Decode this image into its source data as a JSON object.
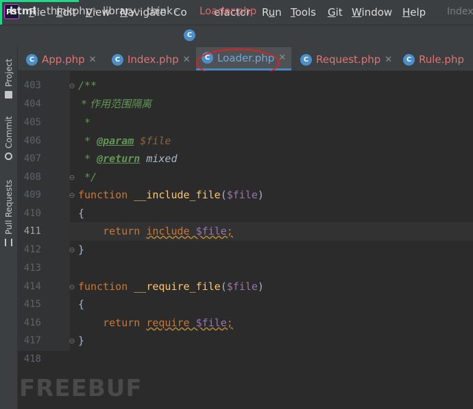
{
  "app": {
    "logo_text": "PS",
    "project_title": "Index"
  },
  "menu": [
    {
      "label": "File",
      "mnemonic": "F",
      "rest": "ile"
    },
    {
      "label": "Edit",
      "mnemonic": "E",
      "rest": "dit"
    },
    {
      "label": "View",
      "mnemonic": "V",
      "rest": "iew"
    },
    {
      "label": "Navigate",
      "mnemonic": "N",
      "rest": "avigate"
    },
    {
      "label": "Code",
      "mnemonic": "",
      "rest": "Co"
    },
    {
      "label": "Refactor",
      "mnemonic": "",
      "rest": "efactor"
    },
    {
      "label": "Run",
      "mnemonic": "u",
      "rest": "Rn"
    },
    {
      "label": "Tools",
      "mnemonic": "T",
      "rest": "ools"
    },
    {
      "label": "Git",
      "mnemonic": "G",
      "rest": "it"
    },
    {
      "label": "Window",
      "mnemonic": "W",
      "rest": "indow"
    },
    {
      "label": "Help",
      "mnemonic": "H",
      "rest": "elp"
    }
  ],
  "breadcrumb": {
    "items": [
      "html",
      "thinkphp",
      "library",
      "think"
    ],
    "file": "Loader.php",
    "file_icon": "class-c-icon"
  },
  "sidebar": {
    "tabs": [
      {
        "label": "Project",
        "icon": "folder-icon"
      },
      {
        "label": "Commit",
        "icon": "commit-icon"
      },
      {
        "label": "Pull Requests",
        "icon": "pull-request-icon"
      }
    ]
  },
  "tabs": [
    {
      "label": "App.php",
      "icon": "class-c-icon",
      "active": false
    },
    {
      "label": "Index.php",
      "icon": "class-c-icon",
      "active": false
    },
    {
      "label": "Loader.php",
      "icon": "class-c-icon",
      "active": true
    },
    {
      "label": "Request.php",
      "icon": "class-c-icon",
      "active": false
    },
    {
      "label": "Rule.php",
      "icon": "class-c-icon",
      "active": false
    }
  ],
  "editor": {
    "current_line": 411,
    "lines": [
      {
        "n": "403",
        "text": "/**"
      },
      {
        "n": "404",
        "text": " * 作用范围隔离"
      },
      {
        "n": "405",
        "text": " *"
      },
      {
        "n": "406",
        "text": " * @param $file"
      },
      {
        "n": "407",
        "text": " * @return mixed"
      },
      {
        "n": "408",
        "text": " */"
      },
      {
        "n": "409",
        "text": "function __include_file($file)"
      },
      {
        "n": "410",
        "text": "{"
      },
      {
        "n": "411",
        "text": "    return include $file;"
      },
      {
        "n": "412",
        "text": "}"
      },
      {
        "n": "413",
        "text": ""
      },
      {
        "n": "414",
        "text": "function __require_file($file)"
      },
      {
        "n": "415",
        "text": "{"
      },
      {
        "n": "416",
        "text": "    return require $file;"
      },
      {
        "n": "417",
        "text": "}"
      },
      {
        "n": "418",
        "text": ""
      }
    ],
    "tokens": {
      "comment_open": "/**",
      "comment_desc": " * 作用范围隔离",
      "comment_star": " *",
      "param_prefix": " * ",
      "param_tag": "@param",
      "param_var": "$file",
      "return_prefix": " * ",
      "return_tag": "@return",
      "return_type": "mixed",
      "comment_close": " */",
      "kw_function": "function",
      "fn_include": "__include_file",
      "fn_require": "__require_file",
      "paren_open": "(",
      "paren_close": ")",
      "arg": "$file",
      "brace_open": "{",
      "brace_close": "}",
      "kw_return": "return",
      "kw_include": "include",
      "kw_require": "require",
      "semicolon": ";"
    }
  },
  "watermark": "FREEBUF",
  "colors": {
    "keyword": "#cc7832",
    "function": "#ffc66d",
    "variable": "#9876aa",
    "comment": "#629755",
    "annotation_circle": "#e02020"
  }
}
